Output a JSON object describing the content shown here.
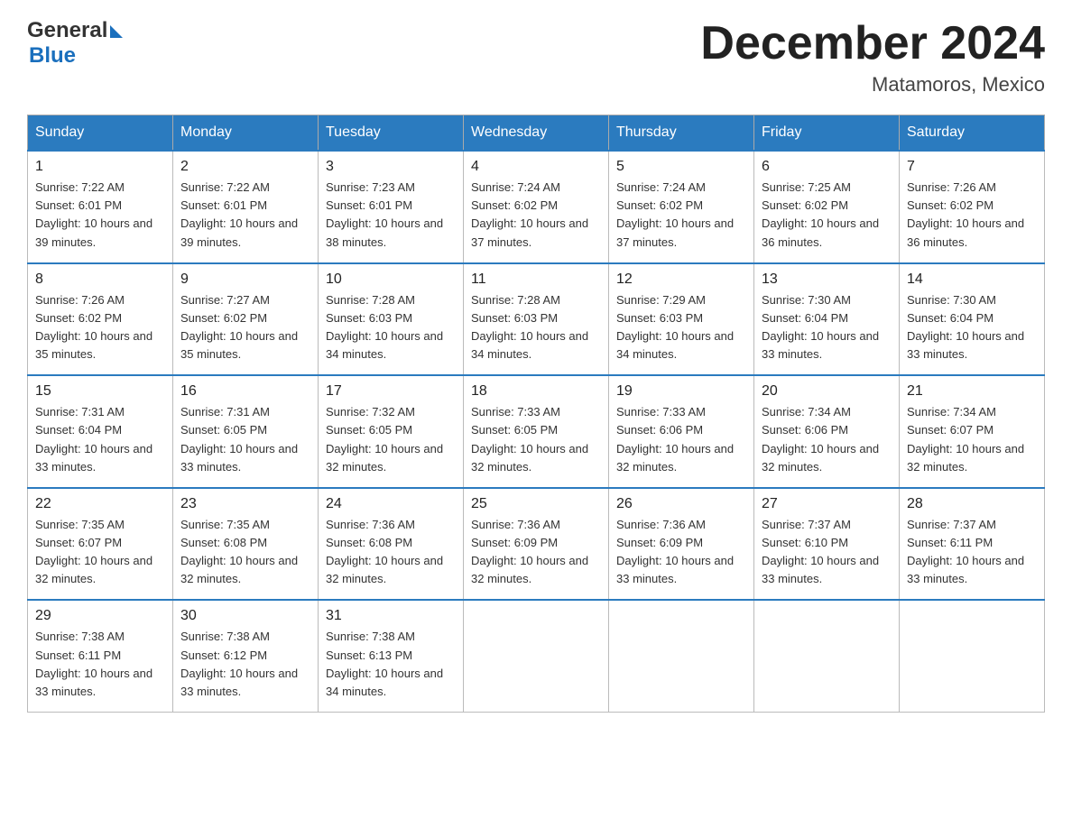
{
  "header": {
    "logo_general": "General",
    "logo_blue": "Blue",
    "month_title": "December 2024",
    "location": "Matamoros, Mexico"
  },
  "days_of_week": [
    "Sunday",
    "Monday",
    "Tuesday",
    "Wednesday",
    "Thursday",
    "Friday",
    "Saturday"
  ],
  "weeks": [
    [
      {
        "day": "1",
        "sunrise": "7:22 AM",
        "sunset": "6:01 PM",
        "daylight": "10 hours and 39 minutes."
      },
      {
        "day": "2",
        "sunrise": "7:22 AM",
        "sunset": "6:01 PM",
        "daylight": "10 hours and 39 minutes."
      },
      {
        "day": "3",
        "sunrise": "7:23 AM",
        "sunset": "6:01 PM",
        "daylight": "10 hours and 38 minutes."
      },
      {
        "day": "4",
        "sunrise": "7:24 AM",
        "sunset": "6:02 PM",
        "daylight": "10 hours and 37 minutes."
      },
      {
        "day": "5",
        "sunrise": "7:24 AM",
        "sunset": "6:02 PM",
        "daylight": "10 hours and 37 minutes."
      },
      {
        "day": "6",
        "sunrise": "7:25 AM",
        "sunset": "6:02 PM",
        "daylight": "10 hours and 36 minutes."
      },
      {
        "day": "7",
        "sunrise": "7:26 AM",
        "sunset": "6:02 PM",
        "daylight": "10 hours and 36 minutes."
      }
    ],
    [
      {
        "day": "8",
        "sunrise": "7:26 AM",
        "sunset": "6:02 PM",
        "daylight": "10 hours and 35 minutes."
      },
      {
        "day": "9",
        "sunrise": "7:27 AM",
        "sunset": "6:02 PM",
        "daylight": "10 hours and 35 minutes."
      },
      {
        "day": "10",
        "sunrise": "7:28 AM",
        "sunset": "6:03 PM",
        "daylight": "10 hours and 34 minutes."
      },
      {
        "day": "11",
        "sunrise": "7:28 AM",
        "sunset": "6:03 PM",
        "daylight": "10 hours and 34 minutes."
      },
      {
        "day": "12",
        "sunrise": "7:29 AM",
        "sunset": "6:03 PM",
        "daylight": "10 hours and 34 minutes."
      },
      {
        "day": "13",
        "sunrise": "7:30 AM",
        "sunset": "6:04 PM",
        "daylight": "10 hours and 33 minutes."
      },
      {
        "day": "14",
        "sunrise": "7:30 AM",
        "sunset": "6:04 PM",
        "daylight": "10 hours and 33 minutes."
      }
    ],
    [
      {
        "day": "15",
        "sunrise": "7:31 AM",
        "sunset": "6:04 PM",
        "daylight": "10 hours and 33 minutes."
      },
      {
        "day": "16",
        "sunrise": "7:31 AM",
        "sunset": "6:05 PM",
        "daylight": "10 hours and 33 minutes."
      },
      {
        "day": "17",
        "sunrise": "7:32 AM",
        "sunset": "6:05 PM",
        "daylight": "10 hours and 32 minutes."
      },
      {
        "day": "18",
        "sunrise": "7:33 AM",
        "sunset": "6:05 PM",
        "daylight": "10 hours and 32 minutes."
      },
      {
        "day": "19",
        "sunrise": "7:33 AM",
        "sunset": "6:06 PM",
        "daylight": "10 hours and 32 minutes."
      },
      {
        "day": "20",
        "sunrise": "7:34 AM",
        "sunset": "6:06 PM",
        "daylight": "10 hours and 32 minutes."
      },
      {
        "day": "21",
        "sunrise": "7:34 AM",
        "sunset": "6:07 PM",
        "daylight": "10 hours and 32 minutes."
      }
    ],
    [
      {
        "day": "22",
        "sunrise": "7:35 AM",
        "sunset": "6:07 PM",
        "daylight": "10 hours and 32 minutes."
      },
      {
        "day": "23",
        "sunrise": "7:35 AM",
        "sunset": "6:08 PM",
        "daylight": "10 hours and 32 minutes."
      },
      {
        "day": "24",
        "sunrise": "7:36 AM",
        "sunset": "6:08 PM",
        "daylight": "10 hours and 32 minutes."
      },
      {
        "day": "25",
        "sunrise": "7:36 AM",
        "sunset": "6:09 PM",
        "daylight": "10 hours and 32 minutes."
      },
      {
        "day": "26",
        "sunrise": "7:36 AM",
        "sunset": "6:09 PM",
        "daylight": "10 hours and 33 minutes."
      },
      {
        "day": "27",
        "sunrise": "7:37 AM",
        "sunset": "6:10 PM",
        "daylight": "10 hours and 33 minutes."
      },
      {
        "day": "28",
        "sunrise": "7:37 AM",
        "sunset": "6:11 PM",
        "daylight": "10 hours and 33 minutes."
      }
    ],
    [
      {
        "day": "29",
        "sunrise": "7:38 AM",
        "sunset": "6:11 PM",
        "daylight": "10 hours and 33 minutes."
      },
      {
        "day": "30",
        "sunrise": "7:38 AM",
        "sunset": "6:12 PM",
        "daylight": "10 hours and 33 minutes."
      },
      {
        "day": "31",
        "sunrise": "7:38 AM",
        "sunset": "6:13 PM",
        "daylight": "10 hours and 34 minutes."
      },
      null,
      null,
      null,
      null
    ]
  ]
}
